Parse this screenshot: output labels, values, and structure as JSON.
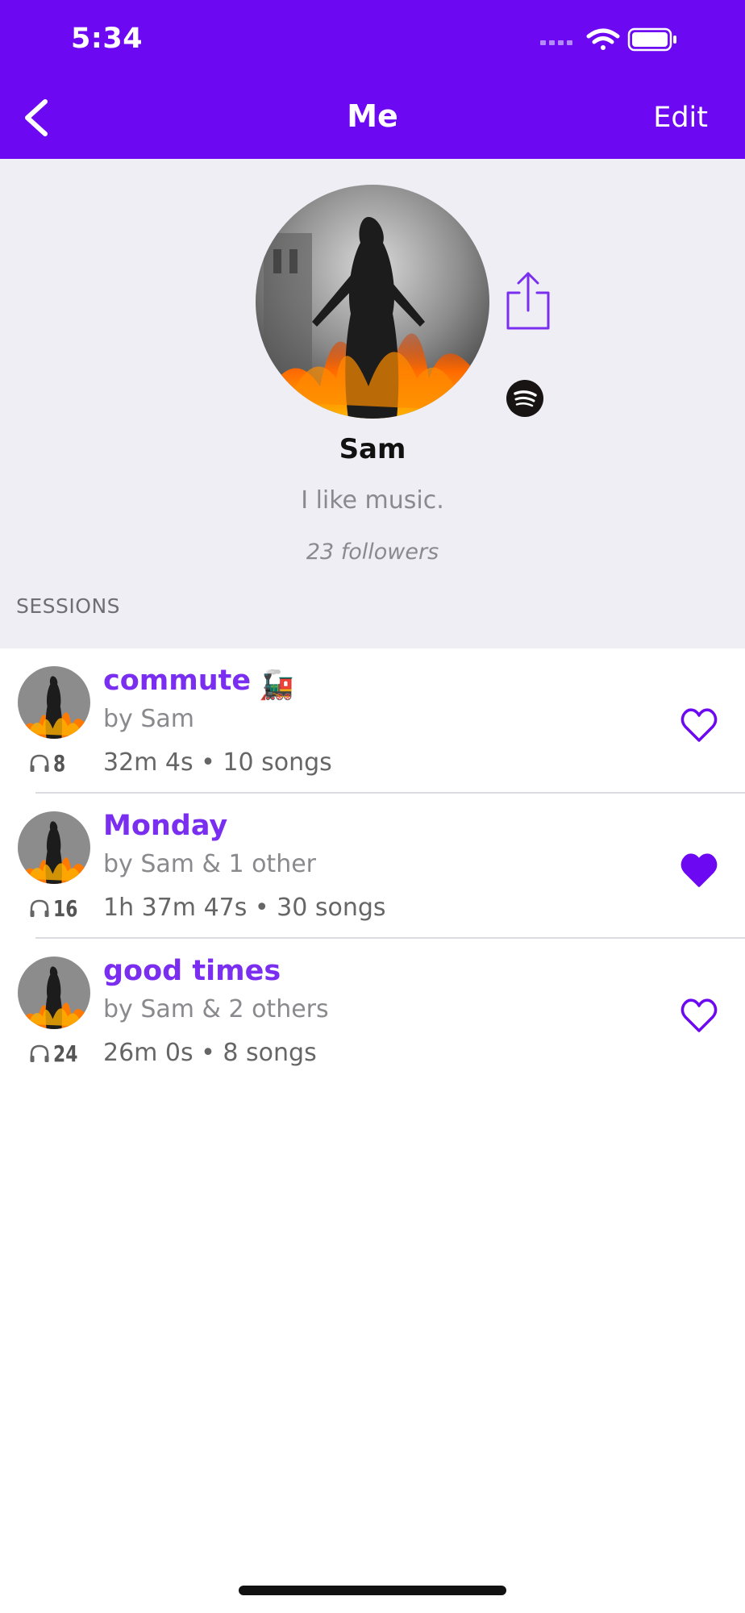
{
  "status_bar": {
    "time": "5:34",
    "icons": [
      "signal-icon",
      "wifi-icon",
      "battery-icon"
    ]
  },
  "nav": {
    "title": "Me",
    "back_icon": "chevron-left-icon",
    "edit_label": "Edit"
  },
  "profile": {
    "name": "Sam",
    "bio": "I like music.",
    "followers": "23 followers",
    "share_icon": "share-icon",
    "service_icon": "spotify-icon"
  },
  "sessions_header": "SESSIONS",
  "sessions": [
    {
      "title": "commute",
      "emoji": "🚂",
      "by": "by Sam",
      "meta": "32m 4s • 10 songs",
      "listens": "8",
      "liked": false
    },
    {
      "title": "Monday",
      "emoji": "",
      "by": "by Sam & 1 other",
      "meta": "1h 37m 47s • 30 songs",
      "listens": "16",
      "liked": true
    },
    {
      "title": "good times",
      "emoji": "",
      "by": "by Sam & 2 others",
      "meta": "26m 0s • 8 songs",
      "listens": "24",
      "liked": false
    }
  ],
  "colors": {
    "accent": "#6d08f2",
    "title_purple": "#7a2ff0",
    "profile_bg": "#efeef4"
  }
}
